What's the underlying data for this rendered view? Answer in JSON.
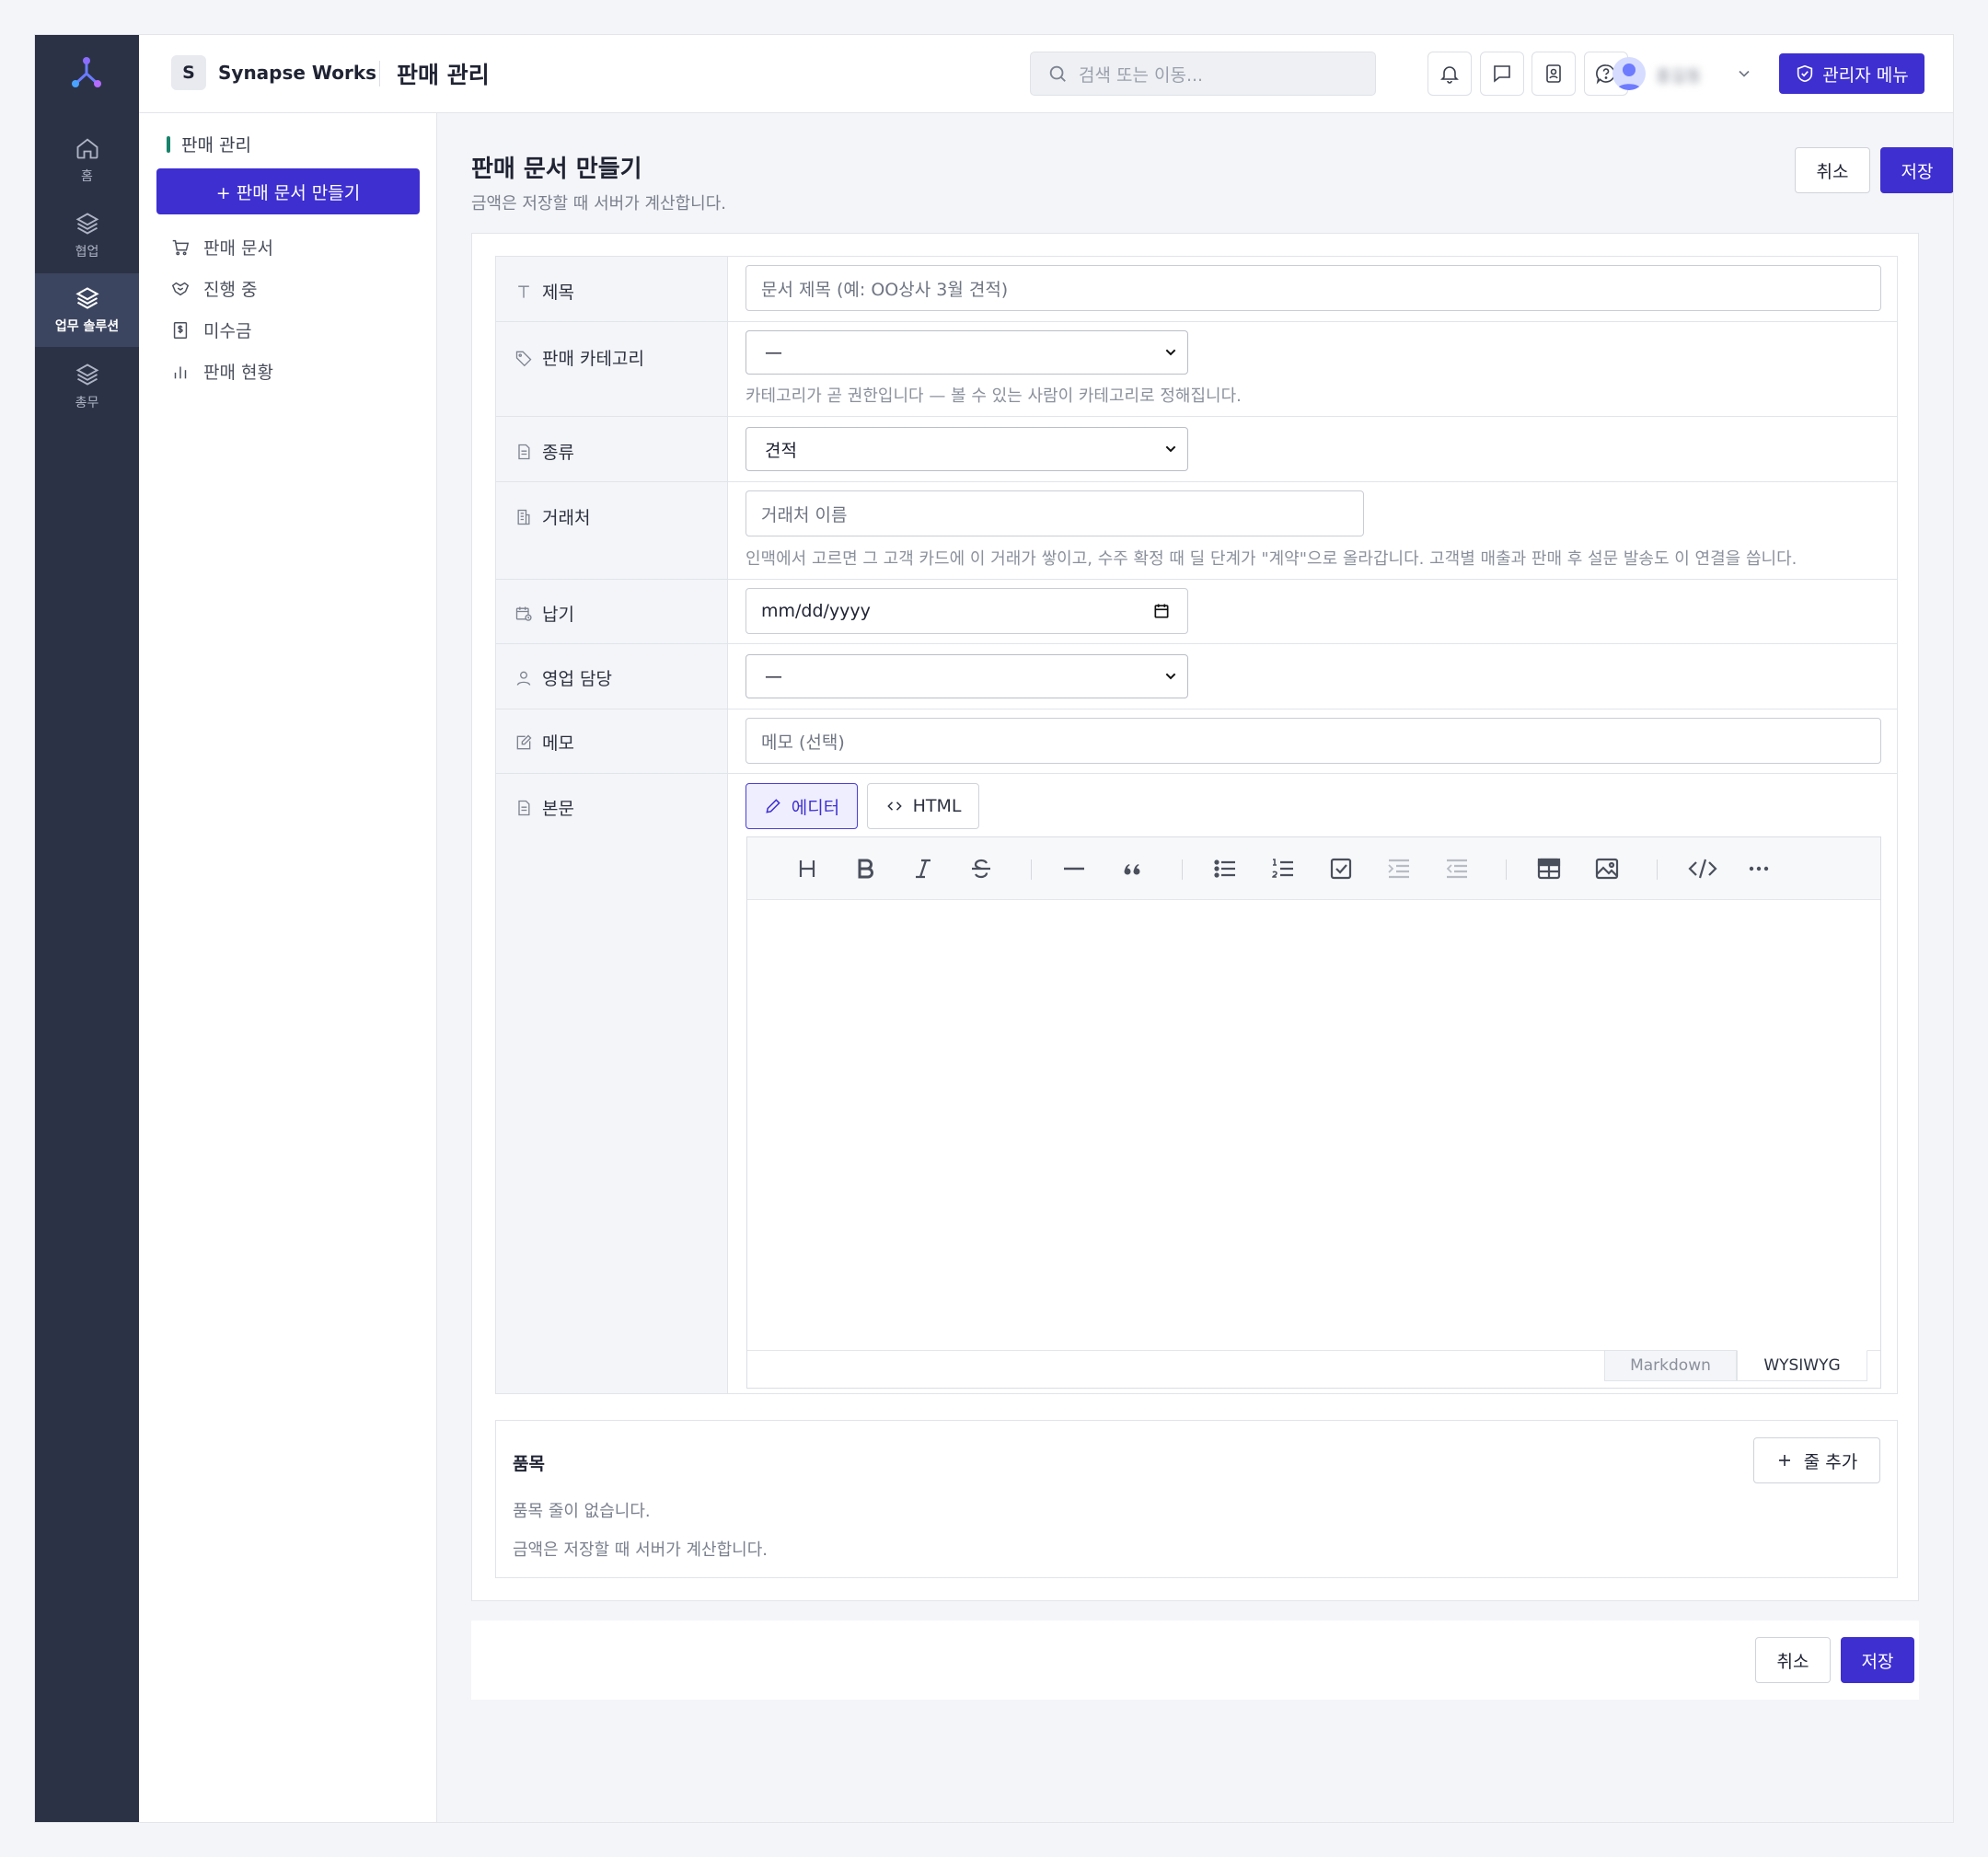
{
  "rail": {
    "items": [
      {
        "label": "홈",
        "icon": "home-icon"
      },
      {
        "label": "협업",
        "icon": "layers-icon"
      },
      {
        "label": "업무 솔루션",
        "icon": "layers-icon",
        "active": true
      },
      {
        "label": "총무",
        "icon": "layers-icon"
      }
    ]
  },
  "topbar": {
    "workspace_initial": "S",
    "workspace_name": "Synapse Works",
    "app_title": "판매 관리",
    "search_placeholder": "검색 또는 이동...",
    "admin_label": "관리자 메뉴",
    "user_name": "홍길동",
    "icons": [
      "bell-icon",
      "chat-icon",
      "contacts-icon",
      "help-icon"
    ]
  },
  "subnav": {
    "section_title": "판매 관리",
    "create_label": "+ 판매 문서 만들기",
    "items": [
      {
        "label": "판매 문서",
        "icon": "cart-icon"
      },
      {
        "label": "진행 중",
        "icon": "handshake-icon"
      },
      {
        "label": "미수금",
        "icon": "receipt-icon"
      },
      {
        "label": "판매 현황",
        "icon": "bar-chart-icon"
      }
    ]
  },
  "page": {
    "title": "판매 문서 만들기",
    "subtitle": "금액은 저장할 때 서버가 계산합니다.",
    "cancel_label": "취소",
    "save_label": "저장"
  },
  "form": {
    "title": {
      "label": "제목",
      "placeholder": "문서 제목 (예: OO상사 3월 견적)"
    },
    "category": {
      "label": "판매 카테고리",
      "value": "—",
      "help": "카테고리가 곧 권한입니다 — 볼 수 있는 사람이 카테고리로 정해집니다."
    },
    "type": {
      "label": "종류",
      "value": "견적"
    },
    "client": {
      "label": "거래처",
      "placeholder": "거래처 이름",
      "help": "인맥에서 고르면 그 고객 카드에 이 거래가 쌓이고, 수주 확정 때 딜 단계가 \"계약\"으로 올라갑니다. 고객별 매출과 판매 후 설문 발송도 이 연결을 씁니다."
    },
    "due": {
      "label": "납기",
      "value": "mm/dd/yyyy"
    },
    "owner": {
      "label": "영업 담당",
      "value": "—"
    },
    "memo": {
      "label": "메모",
      "placeholder": "메모 (선택)"
    },
    "body": {
      "label": "본문",
      "tab_editor": "에디터",
      "tab_html": "HTML",
      "mode_markdown": "Markdown",
      "mode_wysiwyg": "WYSIWYG"
    }
  },
  "items": {
    "title": "품목",
    "add_label": "줄 추가",
    "empty_text": "품목 줄이 없습니다.",
    "note": "금액은 저장할 때 서버가 계산합니다."
  },
  "colors": {
    "primary": "#3e2fd1",
    "rail_bg": "#2b3245",
    "accent_green": "#17836b"
  }
}
